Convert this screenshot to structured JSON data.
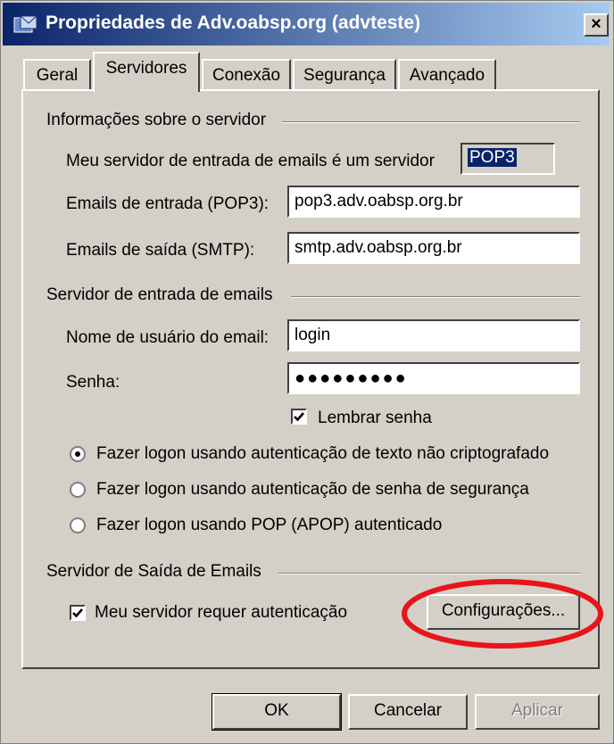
{
  "window": {
    "title": "Propriedades de Adv.oabsp.org (advteste)",
    "close_glyph": "×"
  },
  "tabs": [
    {
      "label": "Geral"
    },
    {
      "label": "Servidores",
      "active": true
    },
    {
      "label": "Conexão"
    },
    {
      "label": "Segurança"
    },
    {
      "label": "Avançado"
    }
  ],
  "server_info": {
    "heading": "Informações sobre o servidor",
    "incoming_type_label": "Meu servidor de entrada de emails é um servidor",
    "incoming_type_value": "POP3",
    "incoming_label": "Emails de entrada (POP3):",
    "incoming_value": "pop3.adv.oabsp.org.br",
    "outgoing_label": "Emails de saída (SMTP):",
    "outgoing_value": "smtp.adv.oabsp.org.br"
  },
  "incoming_server": {
    "heading": "Servidor de entrada de emails",
    "username_label": "Nome de usuário do email:",
    "username_value": "login",
    "password_label": "Senha:",
    "password_value": "●●●●●●●●●",
    "remember_label": "Lembrar senha",
    "remember_checked": true,
    "auth_options": [
      {
        "label": "Fazer logon usando autenticação de texto não criptografado",
        "selected": true
      },
      {
        "label": "Fazer logon usando autenticação de senha de segurança",
        "selected": false
      },
      {
        "label": "Fazer logon usando POP (APOP) autenticado",
        "selected": false
      }
    ]
  },
  "outgoing_server": {
    "heading": "Servidor de Saída de Emails",
    "requires_auth_label": "Meu servidor requer autenticação",
    "requires_auth_checked": true,
    "settings_button": "Configurações..."
  },
  "footer": {
    "ok": "OK",
    "cancel": "Cancelar",
    "apply": "Aplicar"
  },
  "colors": {
    "dialog_bg": "#d4d0c8",
    "titlebar": "#0a246a",
    "highlight_ellipse": "#e8141c"
  },
  "icons": {
    "app": "outlook-express-icon",
    "check": "check-icon"
  }
}
